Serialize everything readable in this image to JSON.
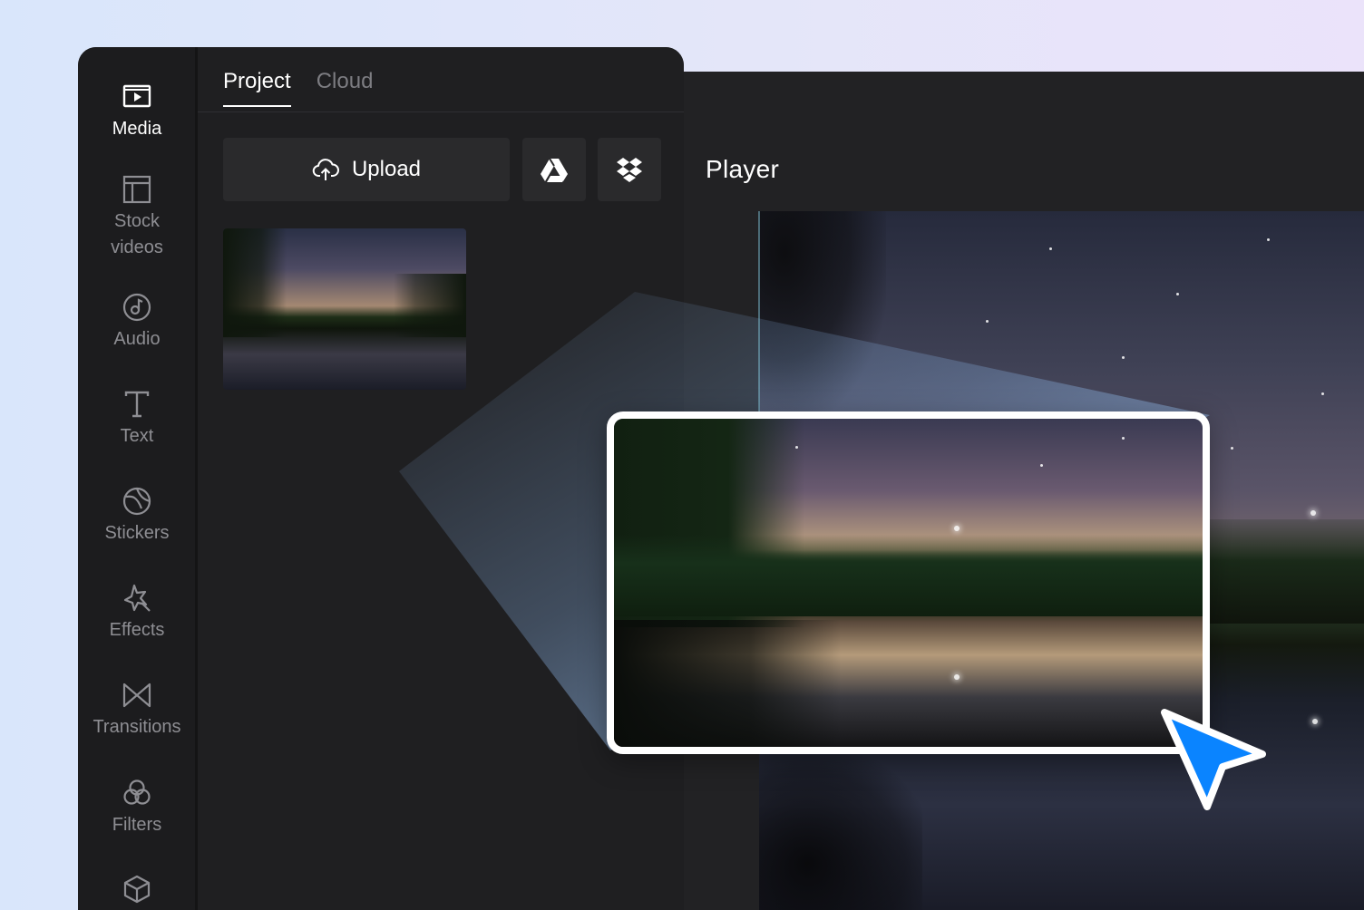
{
  "sidebar": {
    "items": [
      {
        "label": "Media",
        "icon": "media-icon",
        "active": true
      },
      {
        "label": "Stock videos",
        "icon": "stock-videos-icon"
      },
      {
        "label": "Audio",
        "icon": "audio-icon"
      },
      {
        "label": "Text",
        "icon": "text-icon"
      },
      {
        "label": "Stickers",
        "icon": "stickers-icon"
      },
      {
        "label": "Effects",
        "icon": "effects-icon"
      },
      {
        "label": "Transitions",
        "icon": "transitions-icon"
      },
      {
        "label": "Filters",
        "icon": "filters-icon"
      },
      {
        "label": "",
        "icon": "elements-icon"
      }
    ]
  },
  "panel": {
    "tabs": [
      {
        "label": "Project",
        "active": true
      },
      {
        "label": "Cloud",
        "active": false
      }
    ],
    "upload_label": "Upload",
    "sources": [
      "google-drive-icon",
      "dropbox-icon"
    ]
  },
  "player": {
    "title": "Player"
  },
  "colors": {
    "background_start": "#d9e6fb",
    "background_end": "#ebe3fa",
    "editor_bg": "#1c1c1e",
    "cursor_blue": "#0a84ff"
  }
}
